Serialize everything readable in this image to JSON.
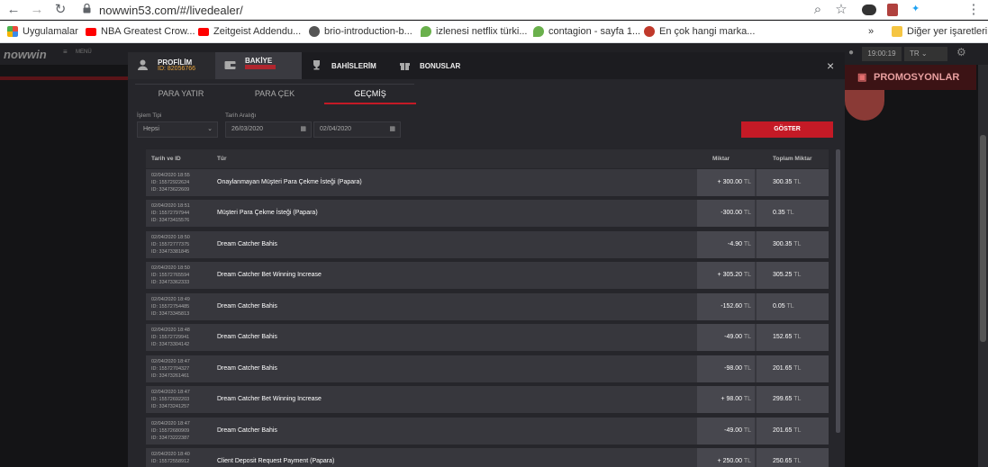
{
  "browser": {
    "url": "nowwin53.com/#/livedealer/",
    "bookmarks": [
      {
        "label": "Uygulamalar",
        "color": "#e84a3c"
      },
      {
        "label": "NBA Greatest Crow...",
        "color": "#ff0000"
      },
      {
        "label": "Zeitgeist Addendu...",
        "color": "#ff0000"
      },
      {
        "label": "brio-introduction-b...",
        "color": "#555555"
      },
      {
        "label": "izlenesi netflix türki...",
        "color": "#6ab04c"
      },
      {
        "label": "contagion - sayfa 1...",
        "color": "#6ab04c"
      },
      {
        "label": "En çok hangi marka...",
        "color": "#c0392b"
      }
    ],
    "overflow": "»",
    "other_bookmarks": "Diğer yer işaretleri"
  },
  "site": {
    "logo": "nowwin",
    "menu_label": "MENÜ",
    "clock": "19:00:19",
    "lang": "TR",
    "promo": "PROMOSYONLAR",
    "accent": "#c41a26"
  },
  "modal": {
    "tabs": [
      {
        "label": "PROFİLİM",
        "sub": "ID: 82056766"
      },
      {
        "label": "BAKİYE",
        "sub": ""
      },
      {
        "label": "BAHİSLERİM",
        "sub": ""
      },
      {
        "label": "BONUSLAR",
        "sub": ""
      }
    ],
    "close": "×",
    "subtabs": [
      "PARA YATIR",
      "PARA ÇEK",
      "GEÇMİŞ"
    ],
    "filters": {
      "type_label": "İşlem Tipi",
      "type_value": "Hepsi",
      "date_label": "Tarih Aralığı",
      "date_from": "26/03/2020",
      "date_to": "02/04/2020",
      "button": "GÖSTER"
    },
    "columns": [
      "Tarih ve ID",
      "Tür",
      "Miktar",
      "Toplam Miktar"
    ],
    "currency": "TL",
    "rows": [
      {
        "date": "02/04/2020 18:55",
        "id1": "ID: 15572922624",
        "id2": "ID: 33473622609",
        "type": "Onaylanmayan Müşteri Para Çekme İsteği (Papara)",
        "amount": "+ 300.00",
        "total": "300.35"
      },
      {
        "date": "02/04/2020 18:51",
        "id1": "ID: 15572797944",
        "id2": "ID: 33473415576",
        "type": "Müşteri Para Çekme İsteği (Papara)",
        "amount": "-300.00",
        "total": "0.35"
      },
      {
        "date": "02/04/2020 18:50",
        "id1": "ID: 15572777375",
        "id2": "ID: 33473381845",
        "type": "Dream Catcher Bahis",
        "amount": "-4.90",
        "total": "300.35"
      },
      {
        "date": "02/04/2020 18:50",
        "id1": "ID: 15572765594",
        "id2": "ID: 33473362333",
        "type": "Dream Catcher Bet Winning Increase",
        "amount": "+ 305.20",
        "total": "305.25"
      },
      {
        "date": "02/04/2020 18:49",
        "id1": "ID: 15572754485",
        "id2": "ID: 33473345813",
        "type": "Dream Catcher Bahis",
        "amount": "-152.60",
        "total": "0.05"
      },
      {
        "date": "02/04/2020 18:48",
        "id1": "ID: 15572729941",
        "id2": "ID: 33473304142",
        "type": "Dream Catcher Bahis",
        "amount": "-49.00",
        "total": "152.65"
      },
      {
        "date": "02/04/2020 18:47",
        "id1": "ID: 15572704327",
        "id2": "ID: 33473261461",
        "type": "Dream Catcher Bahis",
        "amount": "-98.00",
        "total": "201.65"
      },
      {
        "date": "02/04/2020 18:47",
        "id1": "ID: 15572692203",
        "id2": "ID: 33473241257",
        "type": "Dream Catcher Bet Winning Increase",
        "amount": "+ 98.00",
        "total": "299.65"
      },
      {
        "date": "02/04/2020 18:47",
        "id1": "ID: 15572680909",
        "id2": "ID: 33473222387",
        "type": "Dream Catcher Bahis",
        "amount": "-49.00",
        "total": "201.65"
      },
      {
        "date": "02/04/2020 18:40",
        "id1": "ID: 15572558912",
        "id2": "",
        "type": "Client Deposit Request Payment (Papara)",
        "amount": "+ 250.00",
        "total": "250.65"
      }
    ]
  }
}
